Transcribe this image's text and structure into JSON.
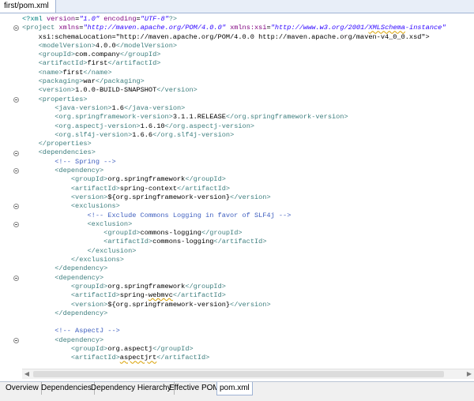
{
  "editor_tab": {
    "title": "first/pom.xml"
  },
  "code_lines": [
    "<?xml version=\"1.0\" encoding=\"UTF-8\"?>",
    "<project xmlns=\"http://maven.apache.org/POM/4.0.0\" xmlns:xsi=\"http://www.w3.org/2001/XMLSchema-instance\"",
    "    xsi:schemaLocation=\"http://maven.apache.org/POM/4.0.0 http://maven.apache.org/maven-v4_0_0.xsd\">",
    "    <modelVersion>4.0.0</modelVersion>",
    "    <groupId>com.company</groupId>",
    "    <artifactId>first</artifactId>",
    "    <name>first</name>",
    "    <packaging>war</packaging>",
    "    <version>1.0.0-BUILD-SNAPSHOT</version>",
    "    <properties>",
    "        <java-version>1.6</java-version>",
    "        <org.springframework-version>3.1.1.RELEASE</org.springframework-version>",
    "        <org.aspectj-version>1.6.10</org.aspectj-version>",
    "        <org.slf4j-version>1.6.6</org.slf4j-version>",
    "    </properties>",
    "    <dependencies>",
    "        <!-- Spring -->",
    "        <dependency>",
    "            <groupId>org.springframework</groupId>",
    "            <artifactId>spring-context</artifactId>",
    "            <version>${org.springframework-version}</version>",
    "            <exclusions>",
    "                <!-- Exclude Commons Logging in favor of SLF4j -->",
    "                <exclusion>",
    "                    <groupId>commons-logging</groupId>",
    "                    <artifactId>commons-logging</artifactId>",
    "                </exclusion>",
    "            </exclusions>",
    "        </dependency>",
    "        <dependency>",
    "            <groupId>org.springframework</groupId>",
    "            <artifactId>spring-webmvc</artifactId>",
    "            <version>${org.springframework-version}</version>",
    "        </dependency>",
    "",
    "        <!-- AspectJ -->",
    "        <dependency>",
    "            <groupId>org.aspectj</groupId>",
    "            <artifactId>aspectjrt</artifactId>"
  ],
  "fold_lines": [
    1,
    9,
    15,
    17,
    21,
    23,
    29,
    36
  ],
  "squiggle_words": [
    "XMLSchema",
    "webmvc",
    "aspectjrt"
  ],
  "bottom_tabs": [
    {
      "label": "Overview",
      "active": false
    },
    {
      "label": "Dependencies",
      "active": false
    },
    {
      "label": "Dependency Hierarchy",
      "active": false
    },
    {
      "label": "Effective POM",
      "active": false
    },
    {
      "label": "pom.xml",
      "active": true
    }
  ],
  "syntax_colors": {
    "tag": "#3f7f7f",
    "attribute": "#7f007f",
    "value": "#2a00ff",
    "comment": "#3f5fbf",
    "text": "#000000"
  }
}
